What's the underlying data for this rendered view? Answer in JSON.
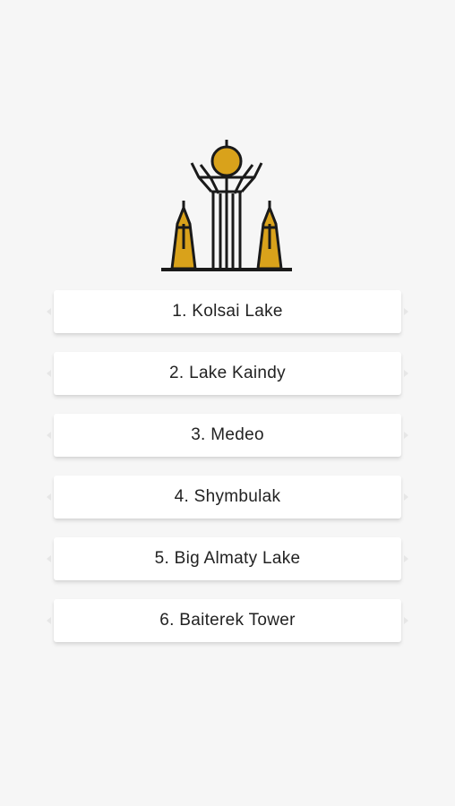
{
  "brand": {
    "logo_icon": "baiterek-tower-icon",
    "accent": "#d9a21b",
    "outline": "#1a1a1a"
  },
  "places": [
    {
      "label": "1. Kolsai Lake"
    },
    {
      "label": "2. Lake Kaindy"
    },
    {
      "label": "3. Medeo"
    },
    {
      "label": "4. Shymbulak"
    },
    {
      "label": "5. Big Almaty Lake"
    },
    {
      "label": "6. Baiterek Tower"
    }
  ]
}
